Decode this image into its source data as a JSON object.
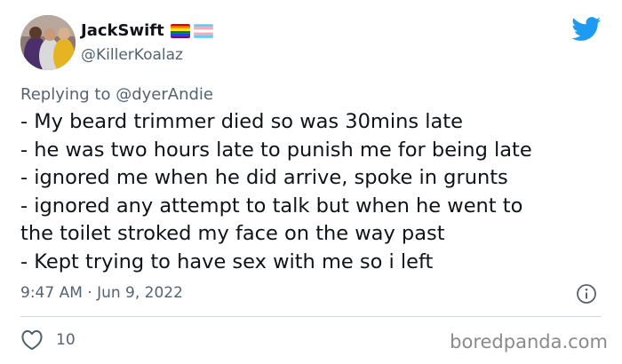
{
  "tweet": {
    "author": {
      "display_name": "JackSwift",
      "handle": "@KillerKoalaz",
      "avatar_icon": "profile-photo",
      "flags": [
        "rainbow-pride-flag",
        "transgender-pride-flag"
      ]
    },
    "replying_to": {
      "prefix": "Replying to",
      "mention": "@dyerAndie"
    },
    "lines": [
      "- My beard trimmer died so was 30mins late",
      "- he was two hours late to punish me for being late",
      "- ignored me when he did arrive, spoke in grunts",
      "- ignored any attempt to talk but when he went to",
      "the toilet stroked my face on the way past",
      "- Kept trying to have sex with me so i left"
    ],
    "timestamp": "9:47 AM · Jun 9, 2022",
    "likes": "10",
    "icons": {
      "brand": "twitter-bird-icon",
      "info": "info-icon",
      "like": "heart-icon"
    },
    "colors": {
      "brand_blue": "#1d9bf0",
      "muted_text": "#536471",
      "divider": "#cfd9de"
    }
  },
  "watermark": "boredpanda.com"
}
